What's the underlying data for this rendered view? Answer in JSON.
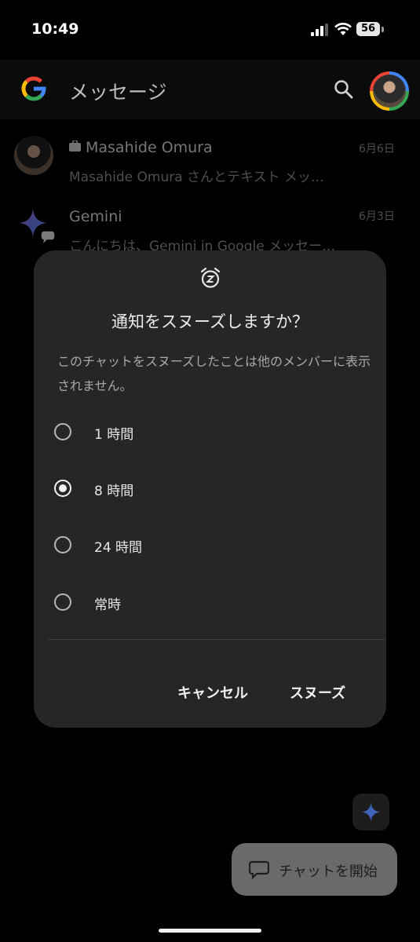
{
  "status_bar": {
    "time": "10:49",
    "battery": "56"
  },
  "app_bar": {
    "title": "メッセージ",
    "logo_icon": "google-g-icon",
    "search_icon": "search-icon"
  },
  "conversations": [
    {
      "name": "Masahide Omura",
      "snippet": "Masahide Omura さんとテキスト メッ…",
      "date": "6月6日"
    },
    {
      "name": "Gemini",
      "snippet": "こんにちは、Gemini in Google メッセー…",
      "date": "6月3日"
    }
  ],
  "dialog": {
    "icon": "snooze-alarm-icon",
    "title": "通知をスヌーズしますか？",
    "body": "このチャットをスヌーズしたことは他のメンバーに表示されません。",
    "options": [
      {
        "label": "1 時間",
        "selected": false
      },
      {
        "label": "8 時間",
        "selected": true
      },
      {
        "label": "24 時間",
        "selected": false
      },
      {
        "label": "常時",
        "selected": false
      }
    ],
    "cancel_label": "キャンセル",
    "confirm_label": "スヌーズ"
  },
  "fab": {
    "start_chat_label": "チャットを開始"
  },
  "colors": {
    "background": "#000000",
    "dialog": "#262626",
    "accent_blue": "#4285f4"
  }
}
